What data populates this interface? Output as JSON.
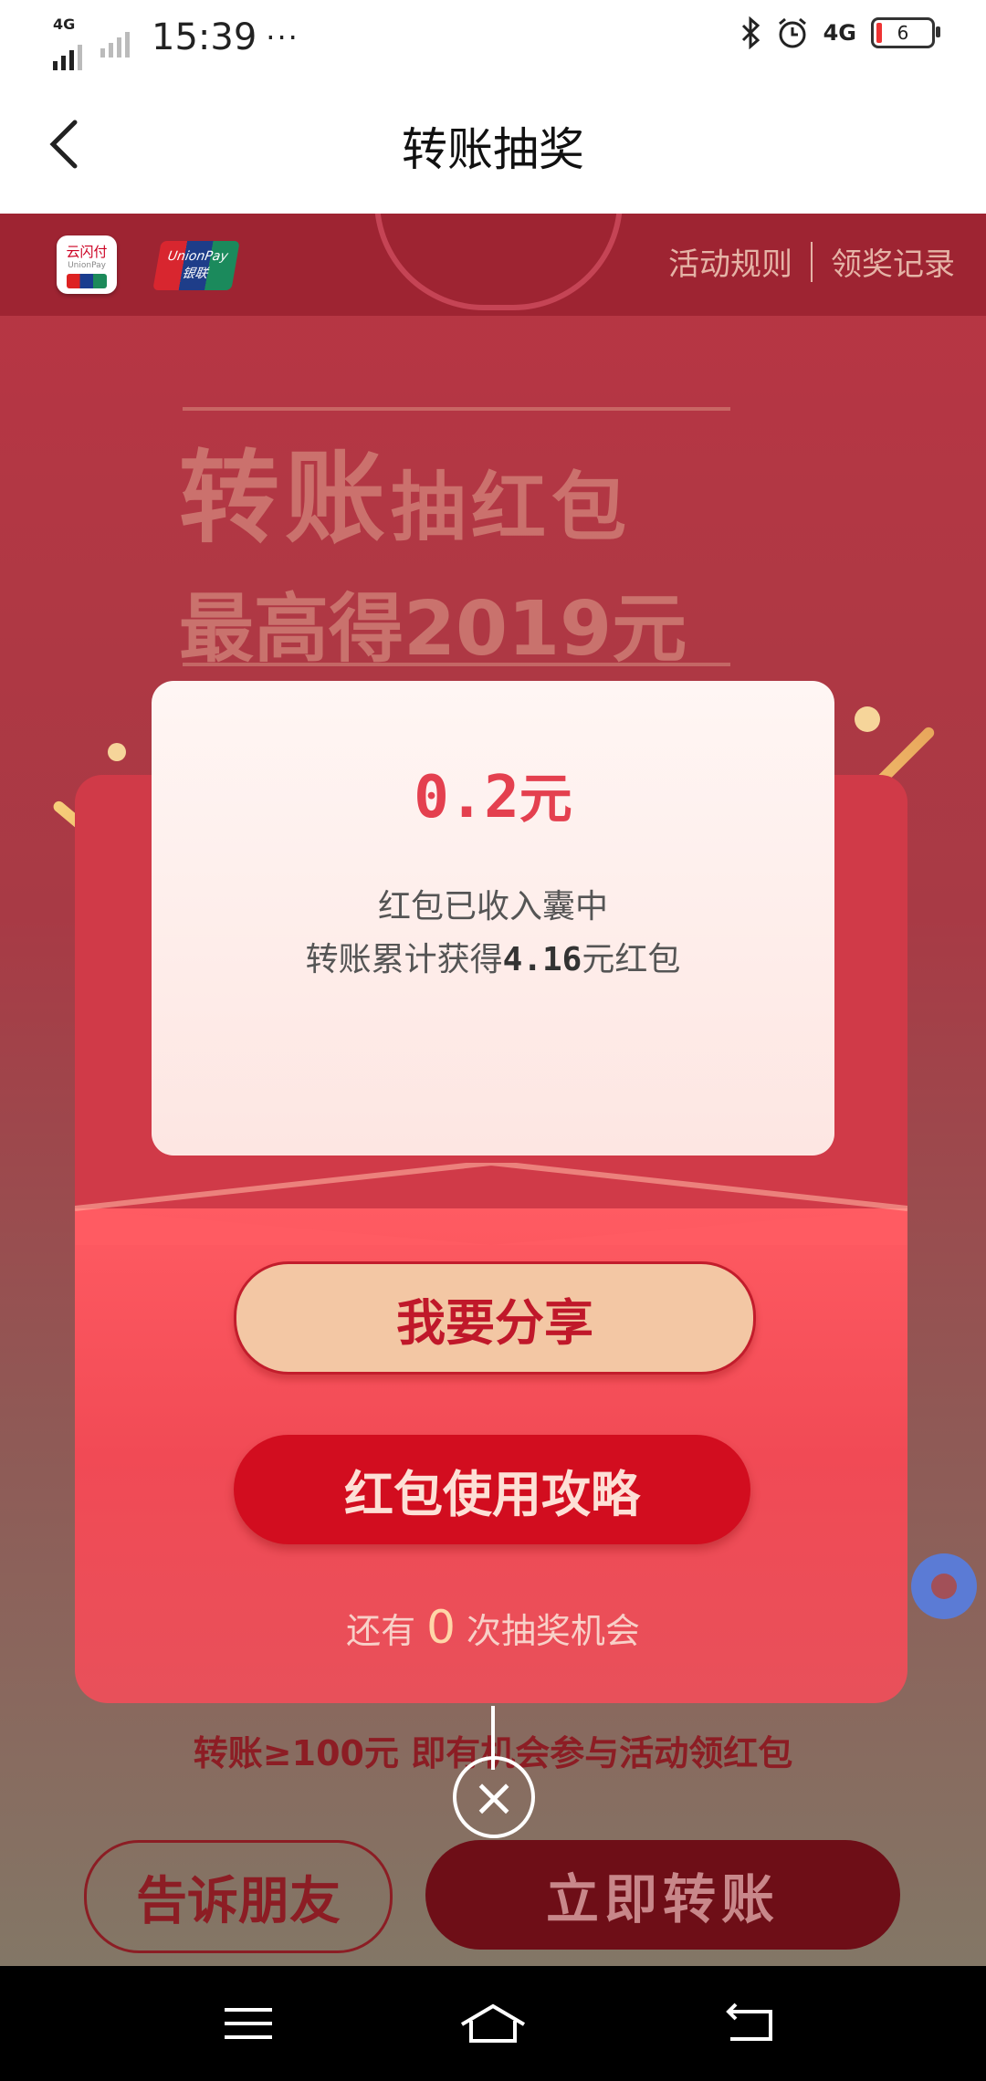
{
  "status_bar": {
    "network_small": "4G",
    "time": "15:39",
    "dots": "···",
    "network_right": "4G",
    "battery": "6"
  },
  "header": {
    "title": "转账抽奖"
  },
  "hero": {
    "logo1_text": "云闪付",
    "logo1_sub": "UnionPay",
    "logo2_text": "UnionPay",
    "logo2_sub": "银联",
    "rules_link": "活动规则",
    "records_link": "领奖记录",
    "headline_big": "转账",
    "headline_small": "抽红包",
    "headline_line2": "最高得2019元"
  },
  "popup": {
    "amount": "0.2",
    "amount_unit": "元",
    "message_line1": "红包已收入囊中",
    "message_line2_prefix": "转账累计获得",
    "message_line2_amount": "4.16",
    "message_line2_suffix": "元红包",
    "share_button": "我要分享",
    "guide_button": "红包使用攻略",
    "chance_prefix": "还有",
    "chance_count": "0",
    "chance_suffix": "次抽奖机会",
    "close_symbol": "×"
  },
  "page": {
    "tip_text": "转账≥100元 即有机会参与活动领红包",
    "tell_friends_button": "告诉朋友",
    "transfer_now_button": "立即转账"
  },
  "colors": {
    "accent_red": "#d20d1f",
    "share_button_bg": "#f3c7a4",
    "amount_red": "#e4404f"
  }
}
